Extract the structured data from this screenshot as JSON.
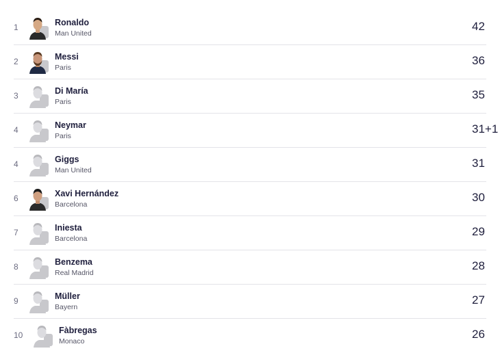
{
  "leaderboard": {
    "rows": [
      {
        "rank": "1",
        "name": "Ronaldo",
        "club": "Man United",
        "value": "42",
        "avatar": "player-photo"
      },
      {
        "rank": "2",
        "name": "Messi",
        "club": "Paris",
        "value": "36",
        "avatar": "player-photo"
      },
      {
        "rank": "3",
        "name": "Di María",
        "club": "Paris",
        "value": "35",
        "avatar": "placeholder-silhouette"
      },
      {
        "rank": "4",
        "name": "Neymar",
        "club": "Paris",
        "value": "31+1",
        "avatar": "placeholder-silhouette"
      },
      {
        "rank": "4",
        "name": "Giggs",
        "club": "Man United",
        "value": "31",
        "avatar": "placeholder-silhouette"
      },
      {
        "rank": "6",
        "name": "Xavi Hernández",
        "club": "Barcelona",
        "value": "30",
        "avatar": "player-photo"
      },
      {
        "rank": "7",
        "name": "Iniesta",
        "club": "Barcelona",
        "value": "29",
        "avatar": "placeholder-silhouette"
      },
      {
        "rank": "8",
        "name": "Benzema",
        "club": "Real Madrid",
        "value": "28",
        "avatar": "placeholder-silhouette"
      },
      {
        "rank": "9",
        "name": "Müller",
        "club": "Bayern",
        "value": "27",
        "avatar": "placeholder-silhouette"
      },
      {
        "rank": "10",
        "name": "Fàbregas",
        "club": "Monaco",
        "value": "26",
        "avatar": "placeholder-silhouette"
      }
    ]
  },
  "colors": {
    "text": "#1e1e3c",
    "muted": "#6b6b80",
    "divider": "#e3e3e8",
    "silhouette": "#c8c8cc"
  }
}
